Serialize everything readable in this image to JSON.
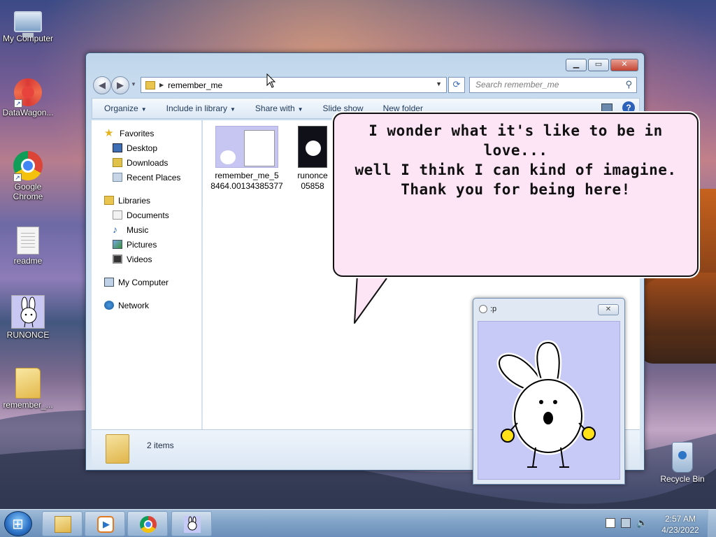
{
  "desktop": {
    "icons": [
      {
        "label": "My Computer",
        "icon": "computer-icon"
      },
      {
        "label": "DataWagon...",
        "icon": "datawagon-icon"
      },
      {
        "label": "Google Chrome",
        "icon": "chrome-icon"
      },
      {
        "label": "readme",
        "icon": "text-document-icon"
      },
      {
        "label": "RUNONCE",
        "icon": "bunny-icon"
      },
      {
        "label": "remember_...",
        "icon": "folder-icon"
      }
    ],
    "recycle_bin": {
      "label": "Recycle Bin",
      "icon": "recycle-bin-icon"
    }
  },
  "explorer": {
    "address": {
      "path": "remember_me"
    },
    "search": {
      "placeholder": "Search remember_me"
    },
    "toolbar": {
      "organize": "Organize",
      "include_in_library": "Include in library",
      "share_with": "Share with",
      "slide_show": "Slide show",
      "new_folder": "New folder"
    },
    "nav": {
      "favorites": "Favorites",
      "desktop": "Desktop",
      "downloads": "Downloads",
      "recent_places": "Recent Places",
      "libraries": "Libraries",
      "documents": "Documents",
      "music": "Music",
      "pictures": "Pictures",
      "videos": "Videos",
      "my_computer": "My Computer",
      "network": "Network"
    },
    "files": [
      {
        "name_line1": "remember_me_5",
        "name_line2": "8464.00134385377"
      },
      {
        "name_line1": "runonce",
        "name_line2": "05858"
      }
    ],
    "status": {
      "count": "2 items"
    }
  },
  "speech_bubble": {
    "line1": "I wonder what it's like to be in love...",
    "line2": "well I think I can kind of imagine.",
    "line3": "Thank you for being here!"
  },
  "pet_window": {
    "title": ":p",
    "close_label": "✕"
  },
  "taskbar": {
    "clock": {
      "time": "2:57 AM",
      "date": "4/23/2022"
    },
    "pinned": [
      "windows-explorer-icon",
      "media-player-icon",
      "chrome-icon",
      "bunny-icon"
    ]
  },
  "colors": {
    "bubble_bg": "#fde5f5",
    "pet_bg": "#c7c9f6",
    "explorer_frame": "#c9dcef"
  }
}
